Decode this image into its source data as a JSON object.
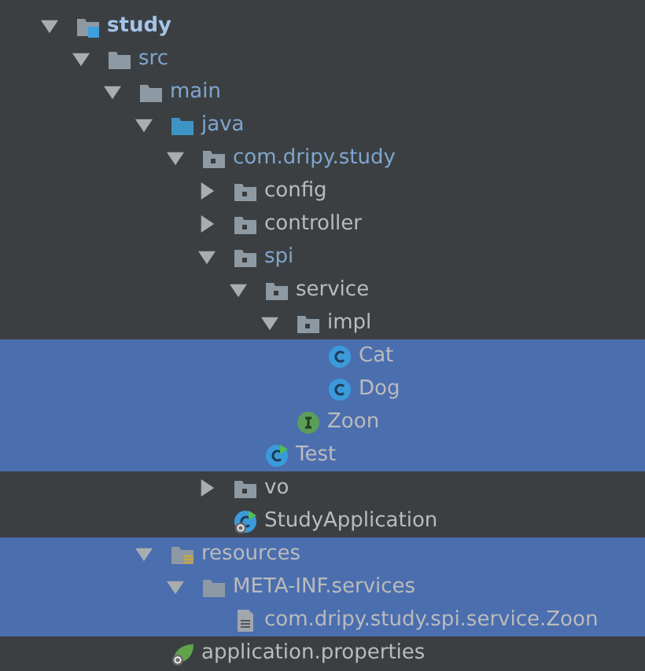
{
  "tree": [
    {
      "label": "study",
      "kind": "module",
      "expanded": true,
      "selected": false,
      "bold": true,
      "color": "#a4c4e8",
      "children": [
        {
          "label": "src",
          "kind": "folder",
          "expanded": true,
          "selected": false,
          "color": "#7fa6cf",
          "children": [
            {
              "label": "main",
              "kind": "folder",
              "expanded": true,
              "selected": false,
              "color": "#7fa6cf",
              "children": [
                {
                  "label": "java",
                  "kind": "source-folder",
                  "expanded": true,
                  "selected": false,
                  "color": "#7fa6cf",
                  "children": [
                    {
                      "label": "com.dripy.study",
                      "kind": "package",
                      "expanded": true,
                      "selected": false,
                      "color": "#7fa6cf",
                      "children": [
                        {
                          "label": "config",
                          "kind": "package",
                          "expanded": false,
                          "selected": false,
                          "color": "#bbbbbb"
                        },
                        {
                          "label": "controller",
                          "kind": "package",
                          "expanded": false,
                          "selected": false,
                          "color": "#bbbbbb"
                        },
                        {
                          "label": "spi",
                          "kind": "package",
                          "expanded": true,
                          "selected": false,
                          "color": "#7fa6cf",
                          "children": [
                            {
                              "label": "service",
                              "kind": "package",
                              "expanded": true,
                              "selected": false,
                              "color": "#bbbbbb",
                              "children": [
                                {
                                  "label": "impl",
                                  "kind": "package",
                                  "expanded": true,
                                  "selected": false,
                                  "color": "#bbbbbb",
                                  "children": [
                                    {
                                      "label": "Cat",
                                      "kind": "class",
                                      "selected": true,
                                      "color": "#bbbbbb"
                                    },
                                    {
                                      "label": "Dog",
                                      "kind": "class",
                                      "selected": true,
                                      "color": "#bbbbbb"
                                    }
                                  ]
                                },
                                {
                                  "label": "Zoon",
                                  "kind": "interface",
                                  "selected": true,
                                  "color": "#bbbbbb"
                                }
                              ]
                            },
                            {
                              "label": "Test",
                              "kind": "main-class",
                              "selected": true,
                              "color": "#bbbbbb"
                            }
                          ]
                        },
                        {
                          "label": "vo",
                          "kind": "package",
                          "expanded": false,
                          "selected": false,
                          "color": "#bbbbbb"
                        },
                        {
                          "label": "StudyApplication",
                          "kind": "boot-class",
                          "selected": false,
                          "color": "#bbbbbb"
                        }
                      ]
                    }
                  ]
                },
                {
                  "label": "resources",
                  "kind": "resources-folder",
                  "expanded": true,
                  "selected": true,
                  "color": "#bbbbbb",
                  "children": [
                    {
                      "label": "META-INF.services",
                      "kind": "folder",
                      "expanded": true,
                      "selected": true,
                      "color": "#bbbbbb",
                      "children": [
                        {
                          "label": "com.dripy.study.spi.service.Zoon",
                          "kind": "file",
                          "selected": true,
                          "color": "#bbbbbb"
                        }
                      ]
                    }
                  ]
                },
                {
                  "label": "application.properties",
                  "kind": "properties",
                  "selected": false,
                  "color": "#bbbbbb"
                }
              ]
            }
          ]
        }
      ]
    }
  ]
}
